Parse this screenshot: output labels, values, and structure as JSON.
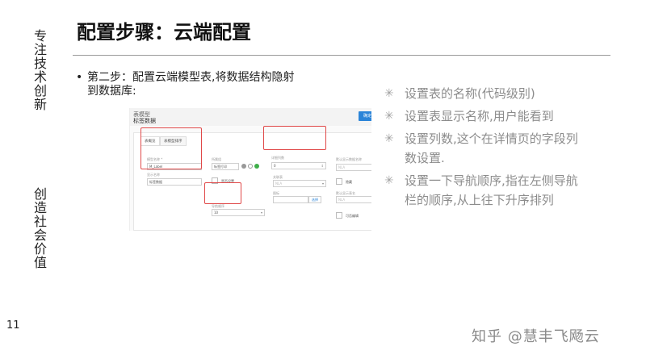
{
  "slide": {
    "title": "配置步骤：云端配置",
    "side_top": "专注技术创新",
    "side_bottom": "创造社会价值",
    "page_number": "11",
    "watermark": "知乎 @慧丰飞飏云"
  },
  "step": {
    "bullet": "•",
    "text": "第二步：配置云端模型表,将数据结构隐射到数据库:"
  },
  "notes": [
    {
      "icon": "✳",
      "text": "设置表的名称(代码级别)"
    },
    {
      "icon": "✳",
      "text": "设置表显示名称,用户能看到"
    },
    {
      "icon": "✳",
      "text": "设置列数,这个在详情页的字段列数设置."
    },
    {
      "icon": "✳",
      "text": "设置一下导航顺序,指在左侧导航栏的顺序,从上往下升序排列"
    }
  ],
  "embedded": {
    "subtitle": "表模型",
    "title": "标签数据",
    "save_button": "确定",
    "tabs": [
      "表概览",
      "表模型排序"
    ],
    "table_name_label": "模型名称 *",
    "table_name_value": "M_Label",
    "display_name_label": "显示名称",
    "display_name_value": "标签数据",
    "group_label": "所属组",
    "group_value": "标签打印",
    "column_count_label": "详细列数",
    "column_count_value": "0",
    "nav_order_label": "导航顺序",
    "nav_order_value": "10",
    "field_a_label": "关联表",
    "field_a_value": "NLA",
    "field_b_label": "图标",
    "field_b_button": "选择",
    "right_label_1": "默认显示数据名称",
    "right_value_1": "NLA",
    "right_label_2": "默认显示表名",
    "right_value_2": "NLA",
    "checkbox_1": "是否设置",
    "checkbox_2": "隐藏",
    "checkbox_3": "可否编辑"
  },
  "colors": {
    "highlight": "#e04848",
    "accent_button": "#2b84d8",
    "note_text": "#8c8c8c"
  }
}
